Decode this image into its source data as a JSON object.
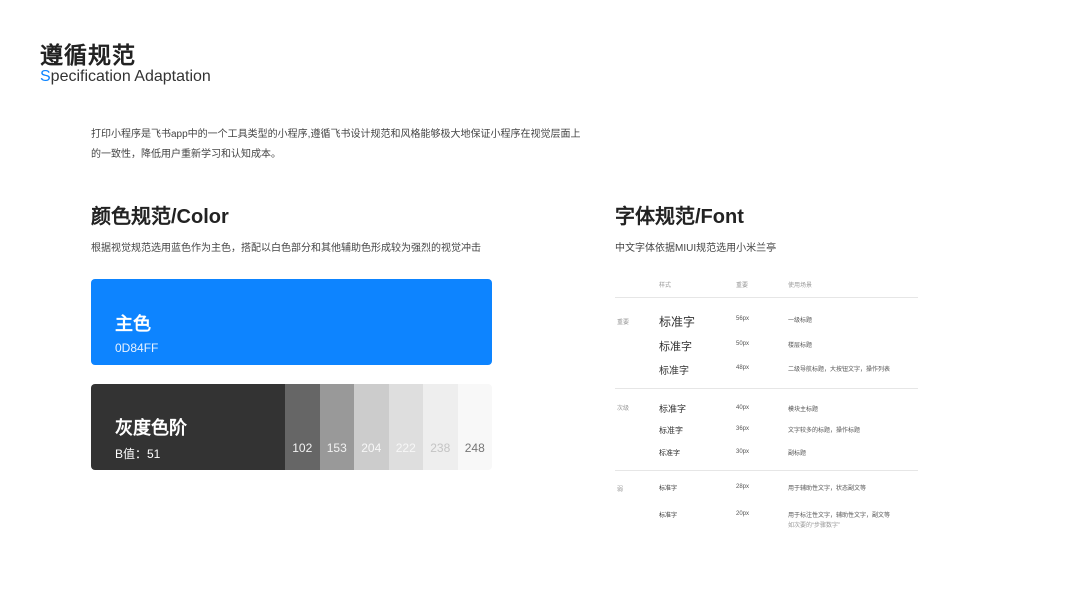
{
  "header": {
    "title_cn": "遵循规范",
    "title_en_first": "S",
    "title_en_rest": "pecification Adaptation"
  },
  "intro": "打印小程序是飞书app中的一个工具类型的小程序,遵循飞书设计规范和风格能够极大地保证小程序在视觉层面上的一致性，降低用户重新学习和认知成本。",
  "color_section": {
    "title": "颜色规范/Color",
    "subtitle": "根据视觉规范选用蓝色作为主色，搭配以白色部分和其他辅助色形成较为强烈的视觉冲击",
    "primary": {
      "name": "主色",
      "hex": "0D84FF",
      "color": "#0D84FF"
    },
    "gray": {
      "name": "灰度色阶",
      "value_label": "B值：51",
      "base_color": "#333333",
      "swatches": [
        {
          "label": "102",
          "color": "#666666",
          "text_color": "#f2f2f2"
        },
        {
          "label": "153",
          "color": "#999999",
          "text_color": "#f2f2f2"
        },
        {
          "label": "204",
          "color": "#cccccc",
          "text_color": "#f7f7f7"
        },
        {
          "label": "222",
          "color": "#dedede",
          "text_color": "#f7f7f7"
        },
        {
          "label": "238",
          "color": "#eeeeee",
          "text_color": "#c4c4c4"
        },
        {
          "label": "248",
          "color": "#f8f8f8",
          "text_color": "#777777"
        }
      ]
    }
  },
  "font_section": {
    "title": "字体规范/Font",
    "subtitle": "中文字体依据MIUI规范选用小米兰亭",
    "headers": {
      "style": "样式",
      "weight": "重要",
      "usage": "使用场景"
    },
    "groups": [
      {
        "category": "重要",
        "rows": [
          {
            "sample": "标准字",
            "size": "56px",
            "usage": "一级标题",
            "note": ""
          },
          {
            "sample": "标准字",
            "size": "50px",
            "usage": "楼层标题",
            "note": ""
          },
          {
            "sample": "标准字",
            "size": "48px",
            "usage": "二级导航标题，大按钮文字，操作列表",
            "note": ""
          }
        ]
      },
      {
        "category": "次级",
        "rows": [
          {
            "sample": "标准字",
            "size": "40px",
            "usage": "模块主标题",
            "note": ""
          },
          {
            "sample": "标准字",
            "size": "36px",
            "usage": "文字较多的标题，操作标题",
            "note": ""
          },
          {
            "sample": "标准字",
            "size": "30px",
            "usage": "副标题",
            "note": ""
          }
        ]
      },
      {
        "category": "弱",
        "rows": [
          {
            "sample": "标准字",
            "size": "28px",
            "usage": "用于辅助性文字，状态副文等",
            "note": ""
          },
          {
            "sample": "标准字",
            "size": "20px",
            "usage": "用于标注性文字，辅助性文字，副文等",
            "note": "如次要的“步骤数字”"
          }
        ]
      }
    ]
  }
}
